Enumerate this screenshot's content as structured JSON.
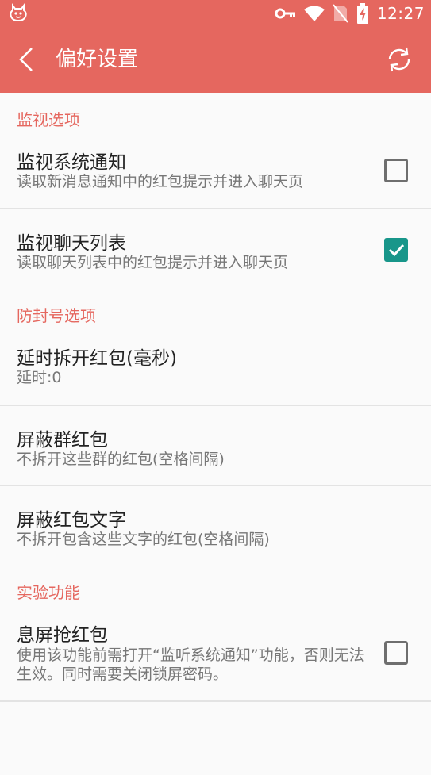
{
  "status_bar": {
    "time": "12:27",
    "icons": [
      "app-notification-icon",
      "key-icon",
      "wifi-icon",
      "no-sim-icon",
      "battery-charging-icon"
    ]
  },
  "app_bar": {
    "title": "偏好设置",
    "back_icon": "back-arrow-icon",
    "refresh_icon": "refresh-icon"
  },
  "colors": {
    "accent": "#e5675f",
    "checkbox_checked": "#18968a"
  },
  "sections": [
    {
      "header": "监视选项",
      "items": [
        {
          "title": "监视系统通知",
          "summary": "读取新消息通知中的红包提示并进入聊天页",
          "checkbox": true,
          "checked": false
        },
        {
          "title": "监视聊天列表",
          "summary": "读取聊天列表中的红包提示并进入聊天页",
          "checkbox": true,
          "checked": true
        }
      ]
    },
    {
      "header": "防封号选项",
      "items": [
        {
          "title": "延时拆开红包(毫秒)",
          "summary": "延时:0"
        },
        {
          "title": "屏蔽群红包",
          "summary": "不拆开这些群的红包(空格间隔)"
        },
        {
          "title": "屏蔽红包文字",
          "summary": "不拆开包含这些文字的红包(空格间隔)"
        }
      ]
    },
    {
      "header": "实验功能",
      "items": [
        {
          "title": "息屏抢红包",
          "summary": "使用该功能前需打开“监听系统通知”功能，否则无法生效。同时需要关闭锁屏密码。",
          "checkbox": true,
          "checked": false
        }
      ]
    }
  ]
}
